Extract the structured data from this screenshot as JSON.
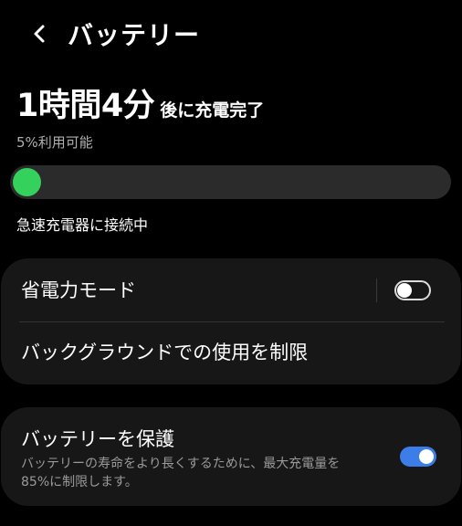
{
  "header": {
    "title": "バッテリー"
  },
  "battery": {
    "time_value": "1時間4分",
    "time_suffix": "後に充電完了",
    "available": "5%利用可能",
    "level": 0.05,
    "fill_color": "#34d15c",
    "charger_status": "急速充電器に接続中"
  },
  "settings": {
    "power_saving": {
      "label": "省電力モード",
      "enabled": false
    },
    "background_limit": {
      "label": "バックグラウンドでの使用を制限"
    },
    "protect_battery": {
      "label": "バッテリーを保護",
      "description": "バッテリーの寿命をより長くするために、最大充電量を85%に制限します。",
      "enabled": true,
      "accent_color": "#3d7de8"
    }
  },
  "icons": {
    "back": "chevron-left-icon"
  }
}
